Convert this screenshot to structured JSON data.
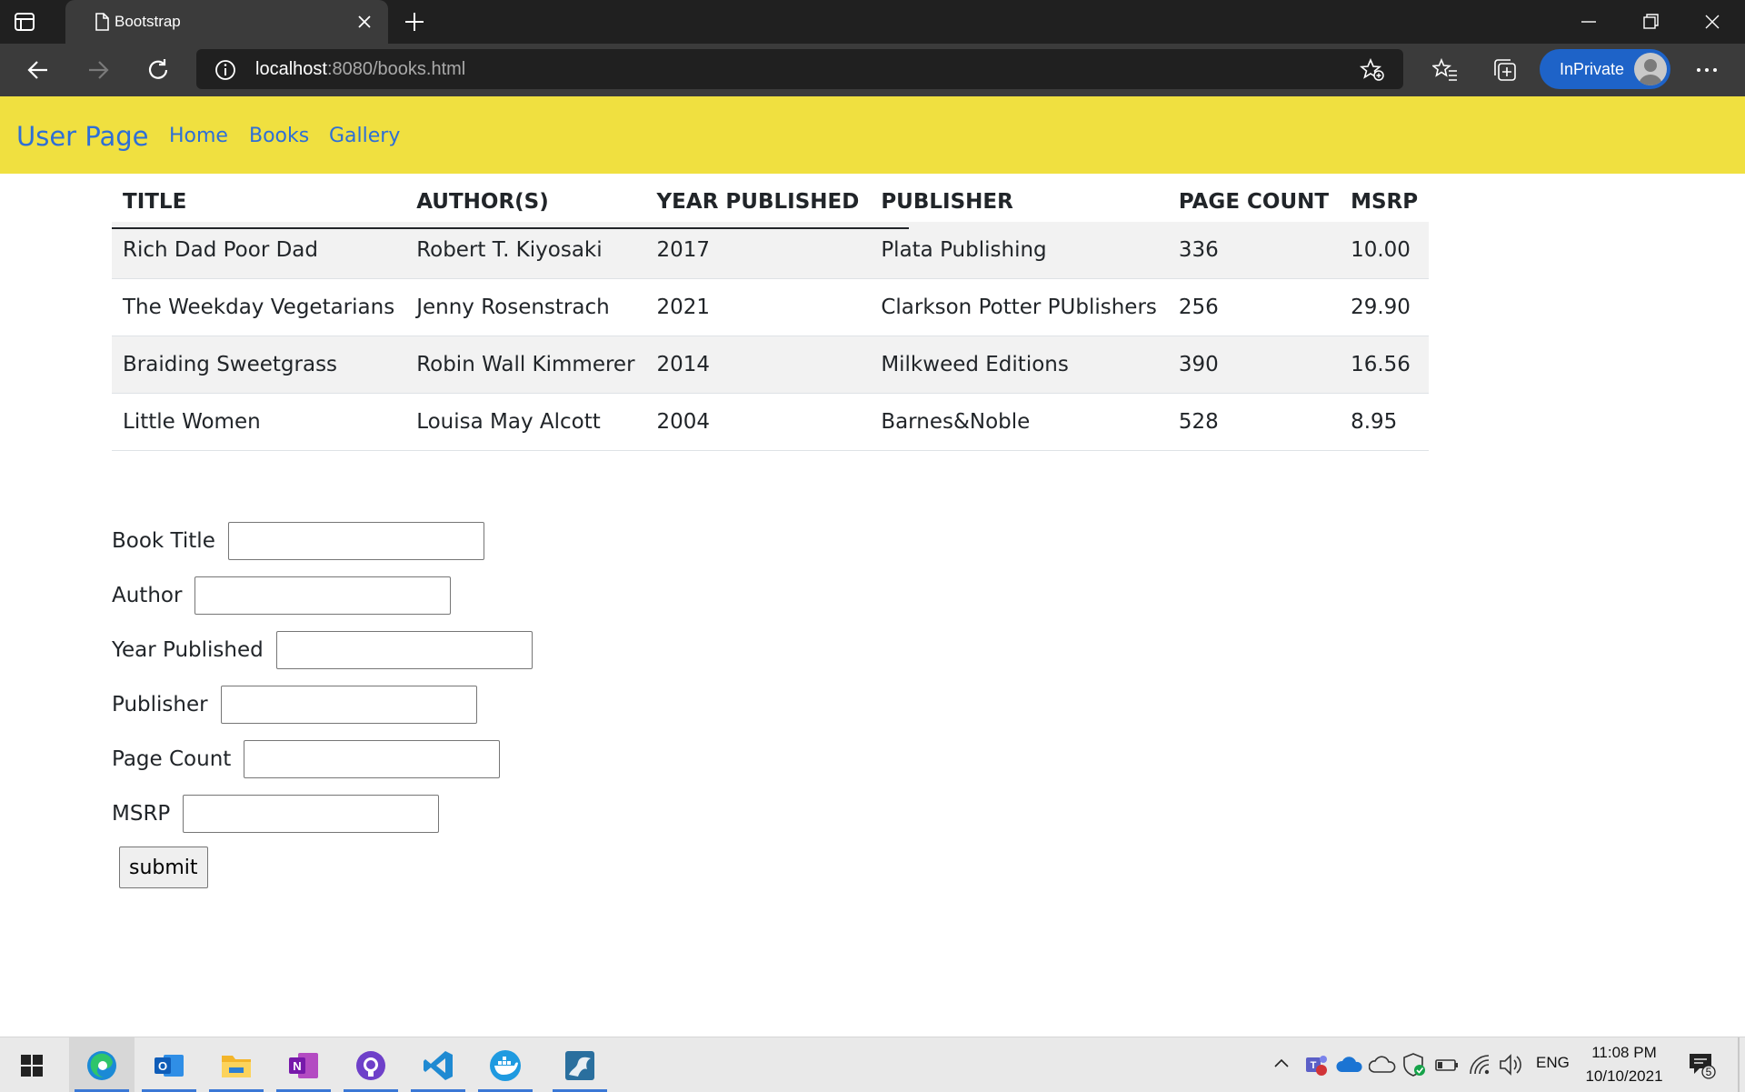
{
  "browser": {
    "tab_title": "Bootstrap",
    "url_host": "localhost",
    "url_rest": ":8080/books.html",
    "inprivate_label": "InPrivate",
    "accent": "#1e63c8"
  },
  "site": {
    "brand": "User Page",
    "nav": [
      "Home",
      "Books",
      "Gallery"
    ],
    "nav_bg": "#f0e040",
    "link_color": "#2e6fd6"
  },
  "table": {
    "headers": [
      "TITLE",
      "AUTHOR(S)",
      "YEAR PUBLISHED",
      "PUBLISHER",
      "PAGE COUNT",
      "MSRP"
    ],
    "rows": [
      [
        "Rich Dad Poor Dad",
        "Robert T. Kiyosaki",
        "2017",
        "Plata Publishing",
        "336",
        "10.00"
      ],
      [
        "The Weekday Vegetarians",
        "Jenny Rosenstrach",
        "2021",
        "Clarkson Potter PUblishers",
        "256",
        "29.90"
      ],
      [
        "Braiding Sweetgrass",
        "Robin Wall Kimmerer",
        "2014",
        "Milkweed Editions",
        "390",
        "16.56"
      ],
      [
        "Little Women",
        "Louisa May Alcott",
        "2004",
        "Barnes&Noble",
        "528",
        "8.95"
      ]
    ]
  },
  "form": {
    "fields": [
      {
        "label": "Book Title",
        "value": ""
      },
      {
        "label": "Author",
        "value": ""
      },
      {
        "label": "Year Published",
        "value": ""
      },
      {
        "label": "Publisher",
        "value": ""
      },
      {
        "label": "Page Count",
        "value": ""
      },
      {
        "label": "MSRP",
        "value": ""
      }
    ],
    "submit_label": "submit"
  },
  "taskbar": {
    "apps": [
      "edge-icon",
      "outlook-icon",
      "file-explorer-icon",
      "onenote-icon",
      "github-desktop-icon",
      "vscode-icon",
      "docker-icon",
      "mysql-workbench-icon"
    ],
    "language": "ENG",
    "time": "11:08 PM",
    "date": "10/10/2021",
    "notification_count": "5"
  }
}
